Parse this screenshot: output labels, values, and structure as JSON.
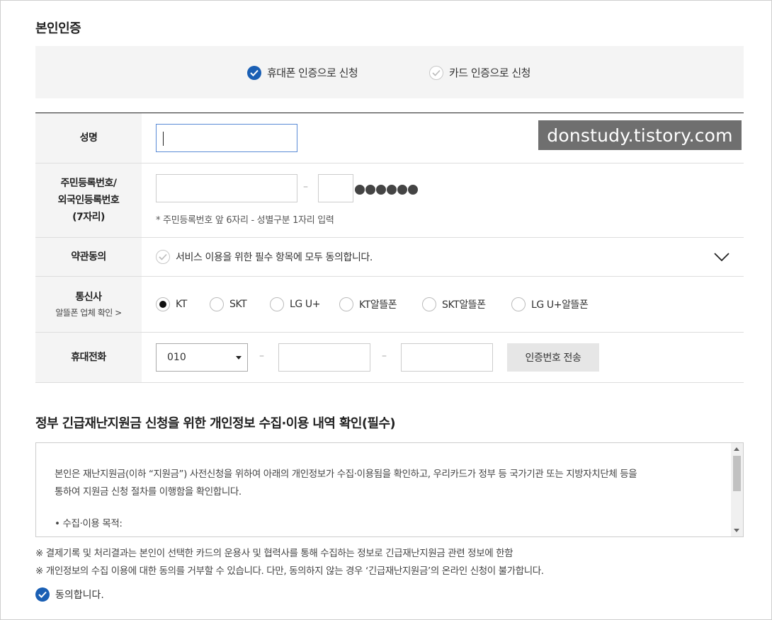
{
  "section_title": "본인인증",
  "auth_methods": [
    {
      "label": "휴대폰 인증으로 신청",
      "selected": true
    },
    {
      "label": "카드 인증으로 신청",
      "selected": false
    }
  ],
  "form": {
    "name": {
      "label": "성명",
      "value": ""
    },
    "rrn": {
      "label_line1": "주민등록번호/",
      "label_line2": "외국인등록번호",
      "label_line3": "(7자리)",
      "masked": "●●●●●●",
      "hint": "* 주민등록번호 앞 6자리 - 성별구분 1자리 입력"
    },
    "terms": {
      "label": "약관동의",
      "text": "서비스 이용을 위한 필수 항목에 모두 동의합니다."
    },
    "carrier": {
      "label": "통신사",
      "sub_link": "알뜰폰 업체 확인 >",
      "options": [
        "KT",
        "SKT",
        "LG U+",
        "KT알뜰폰",
        "SKT알뜰폰",
        "LG U+알뜰폰"
      ],
      "selected": "KT"
    },
    "phone": {
      "label": "휴대전화",
      "prefix": "010",
      "send_button": "인증번호 전송"
    }
  },
  "watermark": "donstudy.tistory.com",
  "privacy": {
    "title": "정부 긴급재난지원금 신청을 위한 개인정보 수집·이용 내역 확인(필수)",
    "body_line1": "본인은 재난지원금(이하 “지원금”) 사전신청을 위하여 아래의 개인정보가 수집·이용됨을 확인하고, 우리카드가 정부 등 국가기관 또는 지방자치단체 등을",
    "body_line2": "통하여 지원금 신청 절차를 이행함을 확인합니다.",
    "body_line3": "• 수집·이용 목적:"
  },
  "notes": [
    "※ 결제기록 및 처리결과는 본인이 선택한 카드의 운용사 및 협력사를 통해 수집하는 정보로 긴급재난지원금 관련 정보에 한함",
    "※ 개인정보의 수집 이용에 대한 동의를 거부할 수 있습니다. 다만, 동의하지 않는 경우 ‘긴급재난지원금’의 온라인 신청이 불가합니다."
  ],
  "agree_label": "동의합니다.",
  "colors": {
    "accent": "#1a5fb4",
    "header_bg": "#f4f4f4",
    "watermark_bg": "#6f6f6f"
  }
}
